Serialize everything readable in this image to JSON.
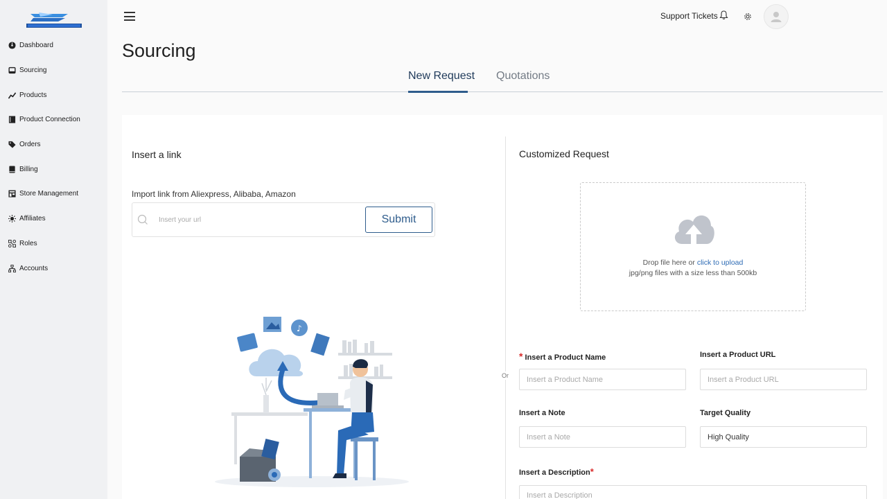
{
  "sidebar": {
    "items": [
      {
        "label": "Dashboard",
        "icon": "dashboard-icon"
      },
      {
        "label": "Sourcing",
        "icon": "inbox-icon"
      },
      {
        "label": "Products",
        "icon": "chart-line-icon"
      },
      {
        "label": "Product Connection",
        "icon": "book-icon"
      },
      {
        "label": "Orders",
        "icon": "tag-icon"
      },
      {
        "label": "Billing",
        "icon": "billing-book-icon"
      },
      {
        "label": "Store Management",
        "icon": "store-icon"
      },
      {
        "label": "Affiliates",
        "icon": "sun-icon"
      },
      {
        "label": "Roles",
        "icon": "roles-icon"
      },
      {
        "label": "Accounts",
        "icon": "network-icon"
      }
    ]
  },
  "header": {
    "support_label": "Support Tickets",
    "title": "Sourcing"
  },
  "tabs": [
    {
      "label": "New Request",
      "active": true
    },
    {
      "label": "Quotations",
      "active": false
    }
  ],
  "link_section": {
    "title": "Insert a link",
    "import_label": "Import link from Aliexpress, Alibaba, Amazon",
    "url_placeholder": "Insert your url",
    "submit_label": "Submit"
  },
  "divider_label": "Or",
  "custom_section": {
    "title": "Customized Request",
    "upload_text": "Drop file here or",
    "upload_link": "click to upload",
    "upload_hint": "jpg/png files with a size less than 500kb",
    "product_name_label": "Insert a Product Name",
    "product_name_placeholder": "Insert a Product Name",
    "product_url_label": "Insert a Product URL",
    "product_url_placeholder": "Insert a Product URL",
    "note_label": "Insert a Note",
    "note_placeholder": "Insert a Note",
    "quality_label": "Target Quality",
    "quality_value": "High Quality",
    "description_label": "Insert a Description",
    "description_placeholder": "Insert a Description",
    "required_mark": "*"
  },
  "colors": {
    "accent": "#2e5c8c",
    "link": "#2e6cb5",
    "required": "#d92b2b",
    "sidebar_bg": "#f0f1f3"
  }
}
